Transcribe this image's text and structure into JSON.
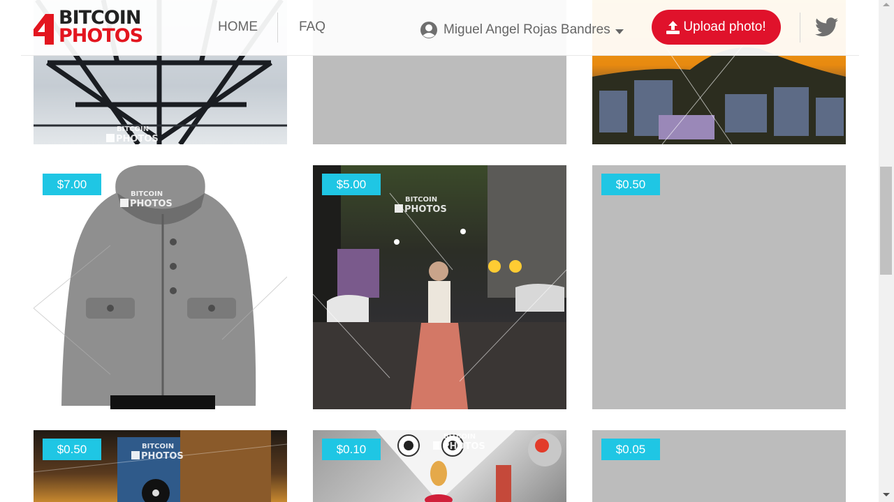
{
  "brand": {
    "logo_top": "BITCOIN",
    "logo_bottom": "PHOTOS",
    "logo_digit": "4",
    "brand_red": "#e3151f"
  },
  "nav": {
    "home": "HOME",
    "faq": "FAQ"
  },
  "user": {
    "name": "Miguel Angel Rojas Bandres",
    "icon": "user-circle-icon"
  },
  "upload": {
    "label": "Upload photo!",
    "icon": "upload-icon",
    "color": "#e0122b"
  },
  "social": {
    "icon": "twitter-icon"
  },
  "colors": {
    "price_badge": "#1fc6e4",
    "placeholder": "#bcbcbc"
  },
  "gallery": {
    "rows": [
      {
        "cards": [
          {
            "price": ""
          },
          {
            "price": ""
          },
          {
            "price": ""
          }
        ]
      },
      {
        "cards": [
          {
            "price": "$7.00"
          },
          {
            "price": "$5.00"
          },
          {
            "price": "$0.50"
          }
        ]
      },
      {
        "cards": [
          {
            "price": "$0.50"
          },
          {
            "price": "$0.10"
          },
          {
            "price": "$0.05"
          }
        ]
      }
    ]
  },
  "watermark": {
    "top": "BITCOIN",
    "bottom": "PHOTOS"
  }
}
